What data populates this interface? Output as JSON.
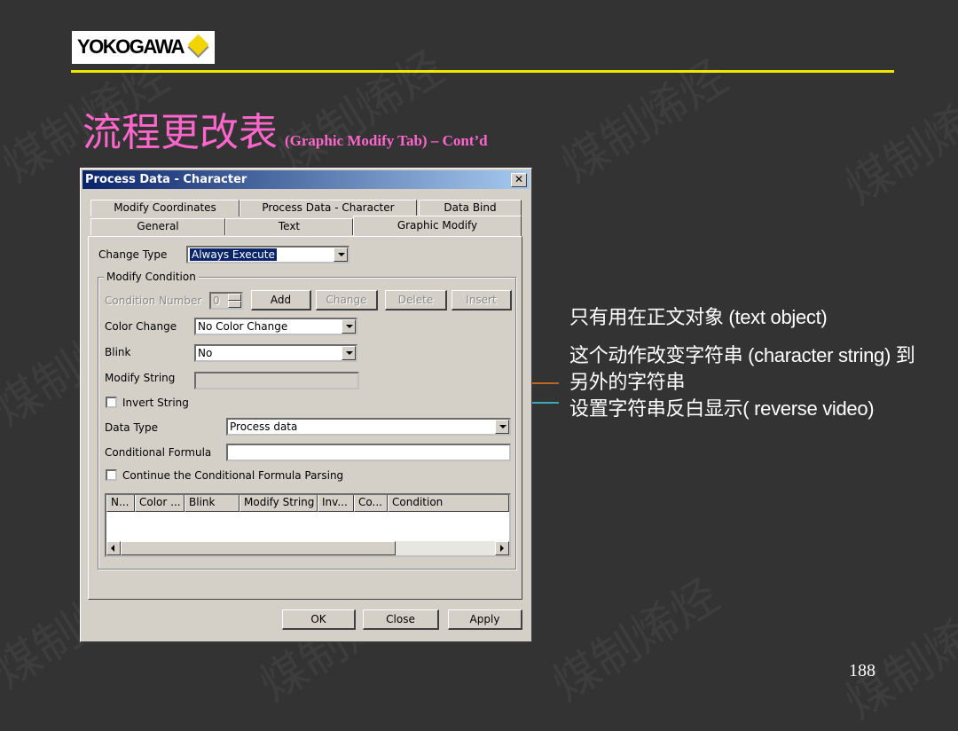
{
  "slide": {
    "logo_text": "YOKOGAWA",
    "title_main": "流程更改表",
    "title_sub": "(Graphic Modify Tab) – Cont’d",
    "page_number": "188",
    "watermark_text": "煤制烯烃",
    "colors": {
      "background": "#333333",
      "title": "#ff66cc",
      "rule": "#f0e800",
      "arrow_orange": "#e87722",
      "arrow_cyan": "#3fd0e0"
    }
  },
  "notes": [
    "只有用在正文对象 (text object)",
    "这个动作改变字符串 (character string) 到另外的字符串",
    "设置字符串反白显示( reverse video)"
  ],
  "dialog": {
    "title": "Process Data - Character",
    "close_glyph": "✕",
    "tabs_top": [
      "Modify Coordinates",
      "Process Data - Character",
      "Data Bind"
    ],
    "tabs_bottom": [
      "General",
      "Text",
      "Graphic Modify"
    ],
    "active_tab": "Graphic Modify",
    "change_type": {
      "label": "Change Type",
      "value": "Always Execute"
    },
    "modify_condition": {
      "title": "Modify Condition",
      "condition_number": {
        "label": "Condition Number",
        "value": "0"
      },
      "buttons": [
        "Add",
        "Change",
        "Delete",
        "Insert"
      ],
      "color_change": {
        "label": "Color Change",
        "value": "No Color Change"
      },
      "blink": {
        "label": "Blink",
        "value": "No"
      },
      "modify_string": {
        "label": "Modify String",
        "value": ""
      },
      "invert_string": {
        "label": "Invert String",
        "checked": false
      },
      "data_type": {
        "label": "Data Type",
        "value": "Process data"
      },
      "conditional_formula": {
        "label": "Conditional Formula",
        "value": ""
      },
      "continue_parsing": {
        "label": "Continue the Conditional Formula Parsing",
        "checked": false
      },
      "list_columns": [
        "N...",
        "Color ...",
        "Blink",
        "Modify String",
        "Inv...",
        "Co...",
        "Condition"
      ]
    },
    "footer_buttons": [
      "OK",
      "Close",
      "Apply"
    ]
  }
}
